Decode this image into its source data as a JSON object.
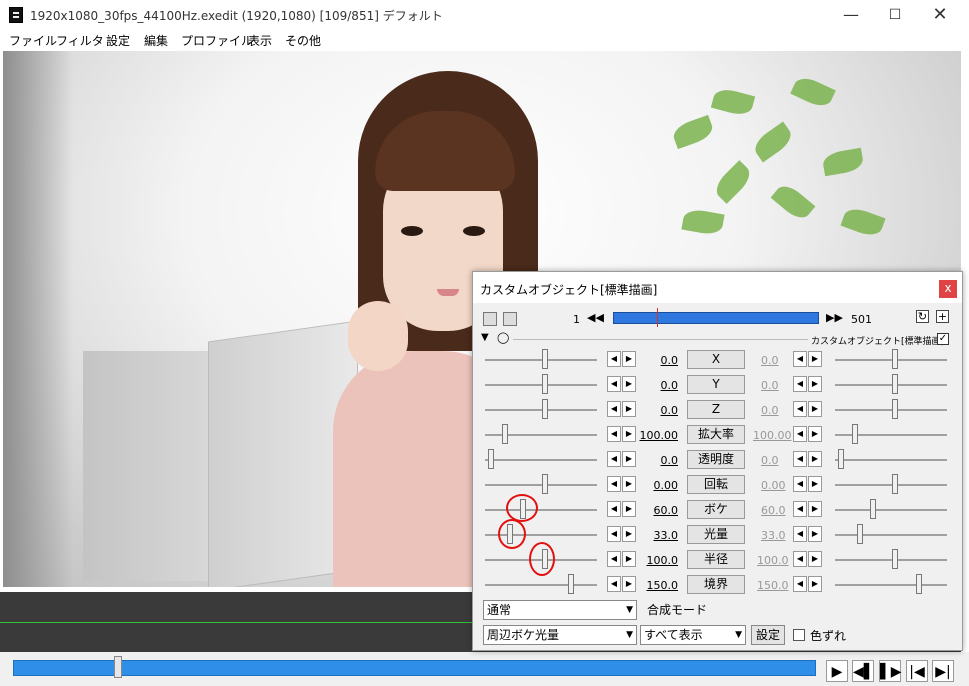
{
  "window": {
    "title": "1920x1080_30fps_44100Hz.exedit (1920,1080)  [109/851]  デフォルト",
    "minimize": "—",
    "maximize": "☐",
    "close": "✕"
  },
  "menu": [
    "ファイル",
    "フィルタ",
    "設定",
    "編集",
    "プロファイル",
    "表示",
    "その他"
  ],
  "playback": {
    "play": "▶",
    "prev": "◀▌",
    "next": "▌▶",
    "first": "|◀",
    "last": "▶|"
  },
  "dialog": {
    "title": "カスタムオブジェクト[標準描画]",
    "close": "x",
    "frame_start": "1",
    "frame_end": "501",
    "rewind": "◀◀",
    "forward": "▶▶",
    "collapse": "▼",
    "object_label": "カスタムオブジェクト[標準描画]",
    "object_checked": "✓",
    "params": [
      {
        "name": "X",
        "left": "0.0",
        "right": "0.0"
      },
      {
        "name": "Y",
        "left": "0.0",
        "right": "0.0"
      },
      {
        "name": "Z",
        "left": "0.0",
        "right": "0.0"
      },
      {
        "name": "拡大率",
        "left": "100.00",
        "right": "100.00"
      },
      {
        "name": "透明度",
        "left": "0.0",
        "right": "0.0"
      },
      {
        "name": "回転",
        "left": "0.00",
        "right": "0.00"
      },
      {
        "name": "ボケ",
        "left": "60.0",
        "right": "60.0"
      },
      {
        "name": "光量",
        "left": "33.0",
        "right": "33.0"
      },
      {
        "name": "半径",
        "left": "100.0",
        "right": "100.0"
      },
      {
        "name": "境界",
        "left": "150.0",
        "right": "150.0"
      }
    ],
    "blend_mode": "通常",
    "blend_label": "合成モード",
    "filter_select": "周辺ボケ光量",
    "show_select": "すべて表示",
    "settings_button": "設定",
    "offset_label": "色ずれ",
    "arrow_left": "◀",
    "arrow_right": "▶",
    "dropdown": "▼"
  }
}
